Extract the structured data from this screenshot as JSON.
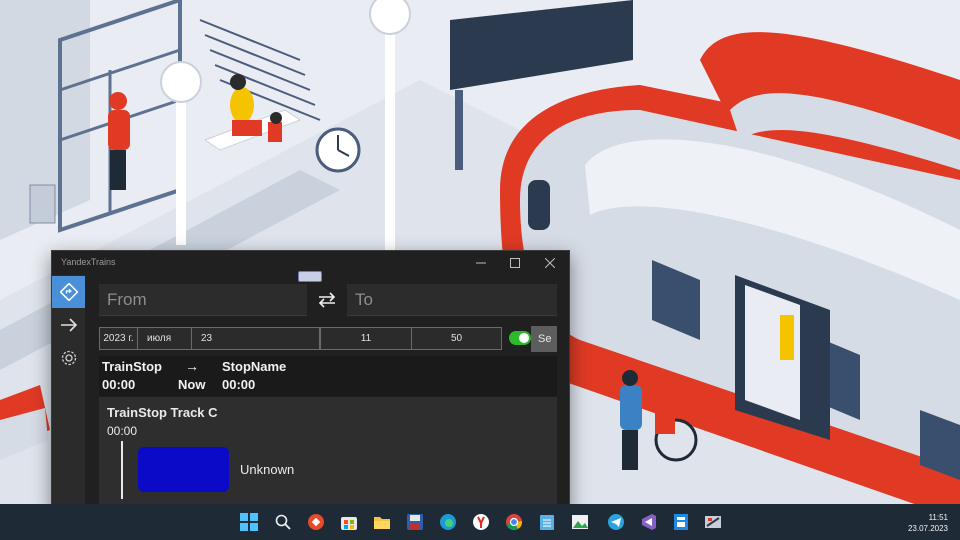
{
  "window": {
    "title": "YandexTrains"
  },
  "sidebar": {
    "items": [
      {
        "icon": "route-icon",
        "active": true
      },
      {
        "icon": "arrow-right-icon",
        "active": false
      },
      {
        "icon": "gear-icon",
        "active": false
      }
    ]
  },
  "search": {
    "from_placeholder": "From",
    "to_placeholder": "To",
    "search_button_label": "Se"
  },
  "datetime": {
    "year": "2023 г.",
    "month": "июля",
    "day": "23",
    "hour": "11",
    "minute": "50",
    "toggle_on": true
  },
  "route": {
    "from_stop": "TrainStop",
    "from_time": "00:00",
    "middle_label": "Now",
    "to_stop": "StopName",
    "to_time": "00:00"
  },
  "results": [
    {
      "title": "TrainStop Track C",
      "time": "00:00",
      "status": "Unknown",
      "color": "#0a0ac8"
    }
  ],
  "taskbar": {
    "icons": [
      "windows-start-icon",
      "search-icon",
      "anydesk-icon",
      "microsoft-store-icon",
      "file-explorer-icon",
      "save-icon",
      "edge-icon",
      "yandex-browser-icon",
      "chrome-icon",
      "notepad-icon",
      "image-editor-icon",
      "telegram-icon",
      "visual-studio-icon",
      "document-app-icon",
      "yandex-trains-app-icon"
    ],
    "time": "11:51",
    "date": "23.07.2023"
  },
  "colors": {
    "accent": "#4a90d9",
    "toggle": "#2eb82e",
    "train_red": "#e03a25",
    "wallpaper_bg": "#e8ecf2"
  }
}
